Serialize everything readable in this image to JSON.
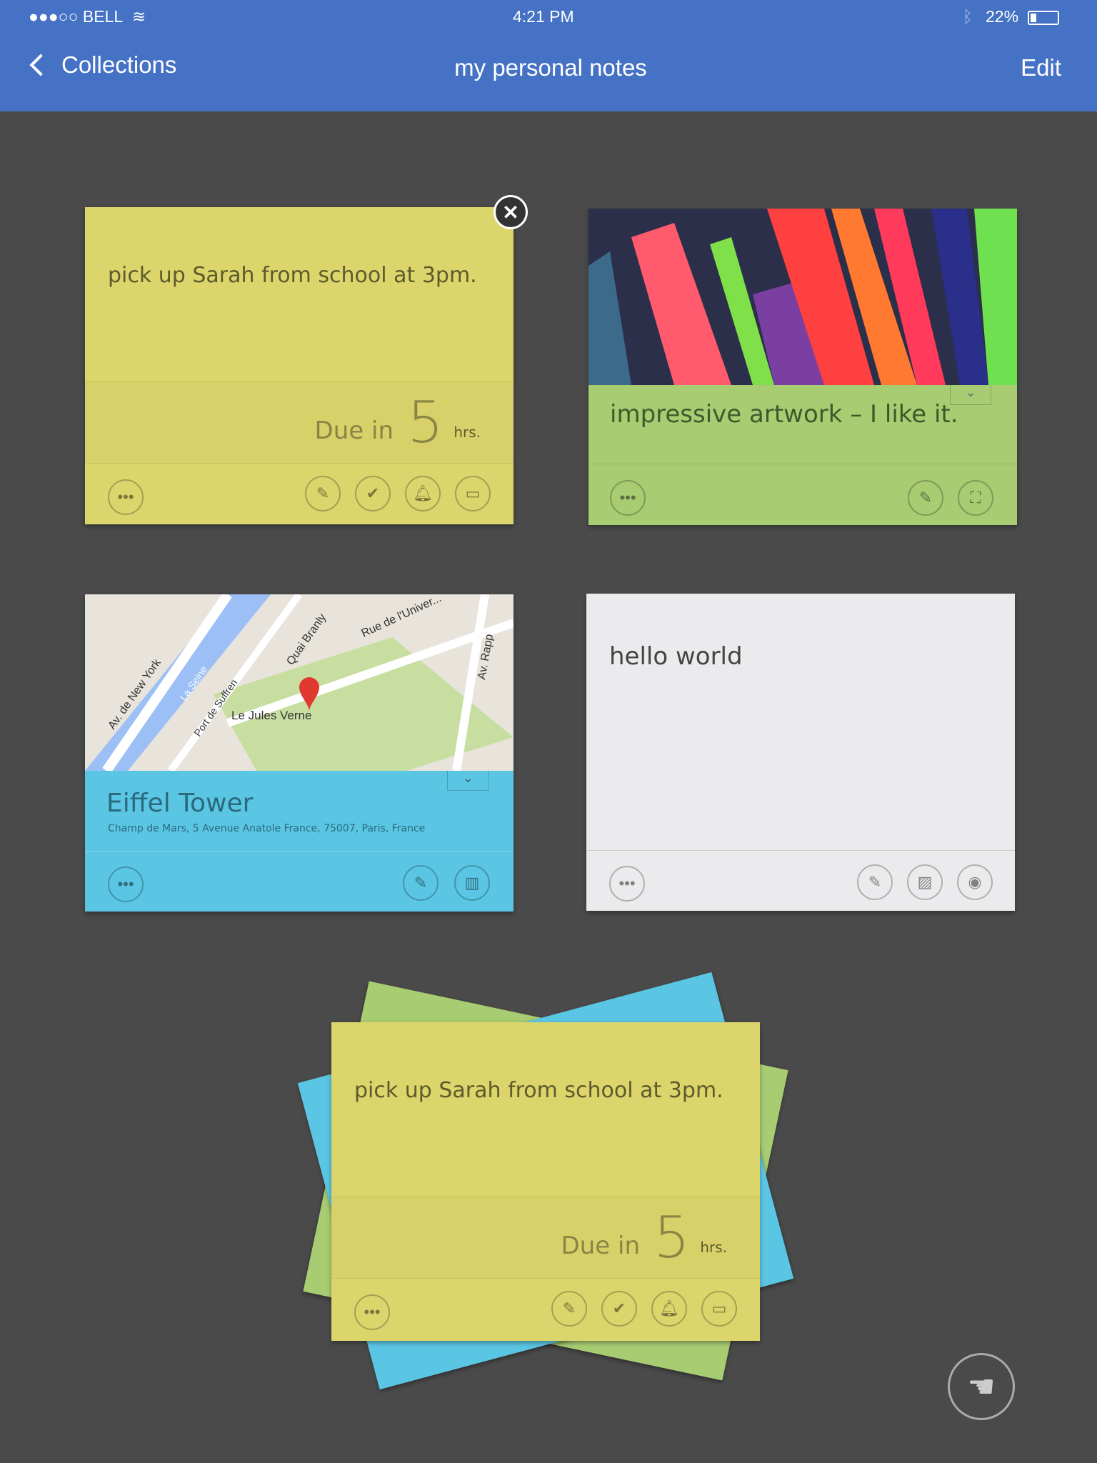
{
  "status_bar": {
    "carrier": "●●●○○ BELL",
    "time": "4:21 PM",
    "battery": "22%"
  },
  "nav": {
    "back_label": "Collections",
    "title": "my personal notes",
    "edit_label": "Edit"
  },
  "notes": [
    {
      "type": "reminder",
      "color": "#dcd56c",
      "text": "pick up Sarah from school at 3pm.",
      "due_prefix": "Due in",
      "due_value": "5",
      "due_unit": "hrs.",
      "actions": [
        "more",
        "edit",
        "done",
        "alarm",
        "calendar"
      ]
    },
    {
      "type": "image",
      "color": "#a8cc72",
      "text": "impressive artwork – I like it.",
      "actions": [
        "more",
        "edit",
        "fullscreen"
      ]
    },
    {
      "type": "location",
      "color": "#5ac6e4",
      "title": "Eiffel Tower",
      "address": "Champ de Mars, 5 Avenue Anatole France, 75007, Paris, France",
      "map_labels": [
        "Av. de New York",
        "La Seine",
        "Port de Suffren",
        "Quai Branly",
        "Rue de l'Univer...",
        "Av. Rapp",
        "Le Jules Verne"
      ],
      "actions": [
        "more",
        "edit",
        "map"
      ]
    },
    {
      "type": "text",
      "color": "#ebebed",
      "text": "hello world",
      "actions": [
        "more",
        "edit",
        "image",
        "camera"
      ]
    }
  ],
  "stack": {
    "text": "pick up Sarah from school at 3pm.",
    "due_prefix": "Due in",
    "due_value": "5",
    "due_unit": "hrs."
  },
  "colors": {
    "nav": "#4572c4",
    "background": "#4a4a4a"
  }
}
